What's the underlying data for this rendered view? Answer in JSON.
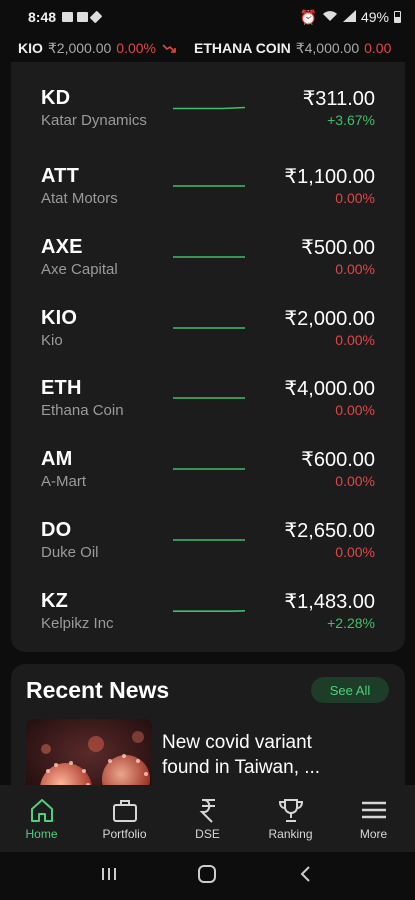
{
  "status_bar": {
    "time": "8:48",
    "battery": "49%"
  },
  "ticker": [
    {
      "symbol": "KIO",
      "price": "₹2,000.00",
      "change": "0.00%"
    },
    {
      "symbol": "ETHANA COIN",
      "price": "₹4,000.00",
      "change": "0.00"
    }
  ],
  "stocks": [
    {
      "symbol": "KD",
      "name": "Katar Dynamics",
      "price": "₹311.00",
      "change": "+3.67%",
      "trend": "up"
    },
    {
      "symbol": "ATT",
      "name": "Atat Motors",
      "price": "₹1,100.00",
      "change": "0.00%",
      "trend": "flat"
    },
    {
      "symbol": "AXE",
      "name": "Axe Capital",
      "price": "₹500.00",
      "change": "0.00%",
      "trend": "flat"
    },
    {
      "symbol": "KIO",
      "name": "Kio",
      "price": "₹2,000.00",
      "change": "0.00%",
      "trend": "flat"
    },
    {
      "symbol": "ETH",
      "name": "Ethana Coin",
      "price": "₹4,000.00",
      "change": "0.00%",
      "trend": "flat"
    },
    {
      "symbol": "AM",
      "name": "A-Mart",
      "price": "₹600.00",
      "change": "0.00%",
      "trend": "flat"
    },
    {
      "symbol": "DO",
      "name": "Duke Oil",
      "price": "₹2,650.00",
      "change": "0.00%",
      "trend": "flat"
    },
    {
      "symbol": "KZ",
      "name": "Kelpikz Inc",
      "price": "₹1,483.00",
      "change": "+2.28%",
      "trend": "up"
    }
  ],
  "news": {
    "section_title": "Recent News",
    "see_all_label": "See All",
    "items": [
      {
        "headline": "New covid variant found in Taiwan, ..."
      }
    ]
  },
  "bottom_nav": [
    {
      "label": "Home",
      "icon": "home-icon",
      "active": true
    },
    {
      "label": "Portfolio",
      "icon": "briefcase-icon",
      "active": false
    },
    {
      "label": "DSE",
      "icon": "rupee-icon",
      "active": false
    },
    {
      "label": "Ranking",
      "icon": "trophy-icon",
      "active": false
    },
    {
      "label": "More",
      "icon": "menu-icon",
      "active": false
    }
  ],
  "colors": {
    "up": "#3fbf6a",
    "down": "#e24747",
    "accent": "#4cd07c",
    "card": "#1c1c1c",
    "background": "#0d0d0d"
  }
}
